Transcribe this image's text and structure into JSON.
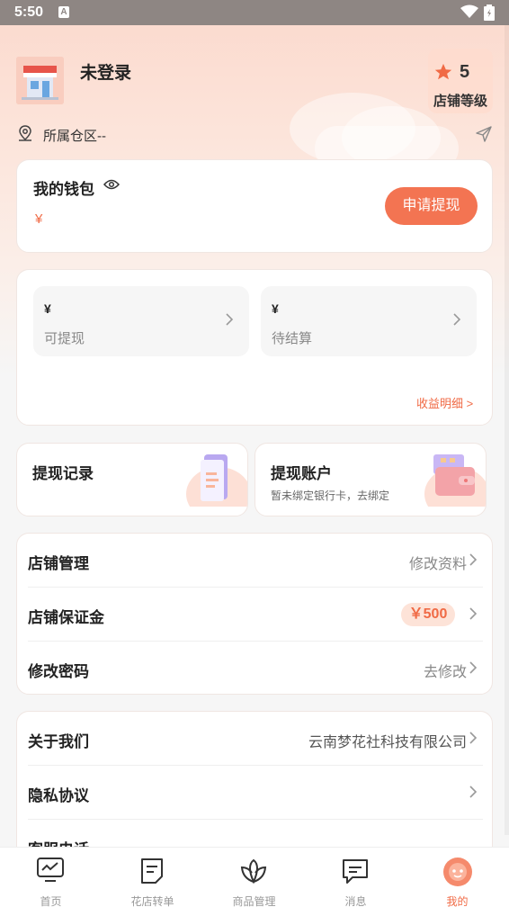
{
  "status_bar": {
    "time": "5:50",
    "notification_letter": "A"
  },
  "profile": {
    "store_name": "未登录",
    "level_value": "5",
    "level_label": "店铺等级",
    "region_label": "所属仓区--"
  },
  "wallet": {
    "title": "我的钱包",
    "amount_symbol": "¥",
    "withdraw_button": "申请提现"
  },
  "earnings": {
    "available": {
      "symbol": "¥",
      "label": "可提现"
    },
    "pending": {
      "symbol": "¥",
      "label": "待结算"
    },
    "detail_link": "收益明细 >"
  },
  "quick_actions": {
    "records": {
      "title": "提现记录"
    },
    "account": {
      "title": "提现账户",
      "subtitle": "暂未绑定银行卡，去绑定"
    }
  },
  "menu_store": [
    {
      "label": "店铺管理",
      "value": "修改资料"
    },
    {
      "label": "店铺保证金",
      "value": "￥500"
    },
    {
      "label": "修改密码",
      "value": "去修改"
    }
  ],
  "menu_about": [
    {
      "label": "关于我们",
      "value": "云南梦花社科技有限公司"
    },
    {
      "label": "隐私协议",
      "value": ""
    },
    {
      "label": "客服电话",
      "value": ""
    }
  ],
  "tabbar": [
    {
      "label": "首页",
      "icon": "monitor-icon"
    },
    {
      "label": "花店转单",
      "icon": "document-icon"
    },
    {
      "label": "商品管理",
      "icon": "flower-icon"
    },
    {
      "label": "消息",
      "icon": "message-icon"
    },
    {
      "label": "我的",
      "icon": "avatar-icon"
    }
  ],
  "colors": {
    "accent": "#f37452",
    "accent_text": "#f06a45"
  }
}
